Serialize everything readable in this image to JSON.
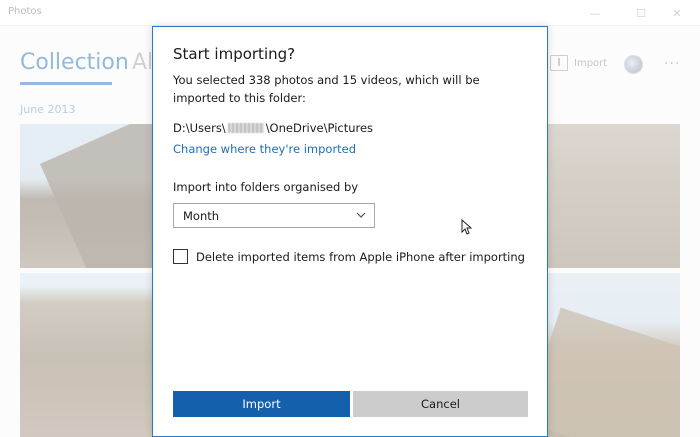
{
  "window": {
    "title": "Photos",
    "minimize_glyph": "—",
    "maximize_glyph": "☐",
    "close_glyph": "✕"
  },
  "nav": {
    "collection_label": "Collection",
    "albums_label": "Al"
  },
  "toolbar": {
    "import_label": "Import",
    "more_label": "···"
  },
  "section": {
    "date_label": "June 2013"
  },
  "dialog": {
    "title": "Start importing?",
    "message": "You selected 338 photos and 15 videos, which will be imported to this folder:",
    "path_prefix": "D:\\Users\\",
    "path_suffix": "\\OneDrive\\Pictures",
    "change_link": "Change where they're imported",
    "organise_label": "Import into folders organised by",
    "organise_selected": "Month",
    "delete_checkbox_label": "Delete imported items from Apple iPhone after importing",
    "delete_checked": false,
    "import_button": "Import",
    "cancel_button": "Cancel"
  },
  "colors": {
    "accent": "#1560ad",
    "link": "#1e6fb8",
    "nav_active": "#5a95c9",
    "dialog_border": "#2b78c6",
    "cancel_bg": "#cccccc"
  },
  "icons": {
    "import": "import-icon",
    "chevron": "chevron-down-icon",
    "account": "avatar",
    "cursor": "mouse-pointer-icon"
  }
}
